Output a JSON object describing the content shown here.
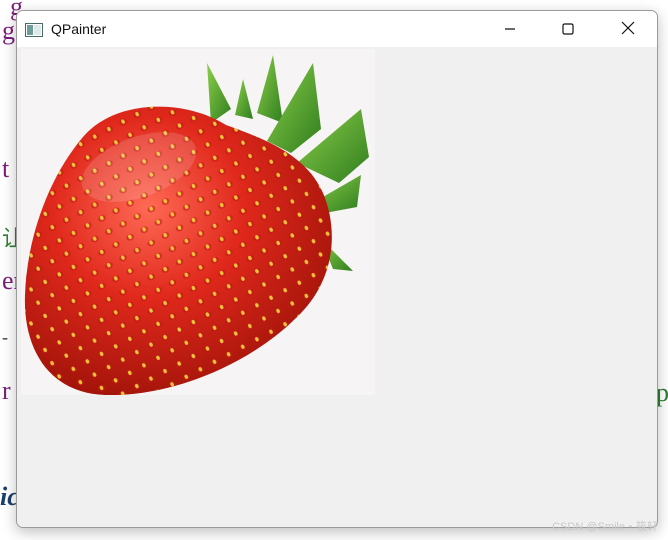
{
  "window": {
    "title": "QPainter",
    "app_icon": "qt-window-icon",
    "controls": {
      "minimize_icon": "minimize-icon",
      "maximize_icon": "maximize-icon",
      "close_icon": "close-icon"
    }
  },
  "content": {
    "image_subject": "strawberry"
  },
  "background_fragments": [
    "g",
    "ge",
    "t :",
    "让",
    "er",
    "-",
    "r :",
    "p",
    "ic"
  ],
  "watermark": "CSDN @Smile・筱轩",
  "colors": {
    "titlebar": "#ffffff",
    "client": "#f0f0f0",
    "strawberry": "#e0281c",
    "leaves": "#3f9a2a"
  }
}
